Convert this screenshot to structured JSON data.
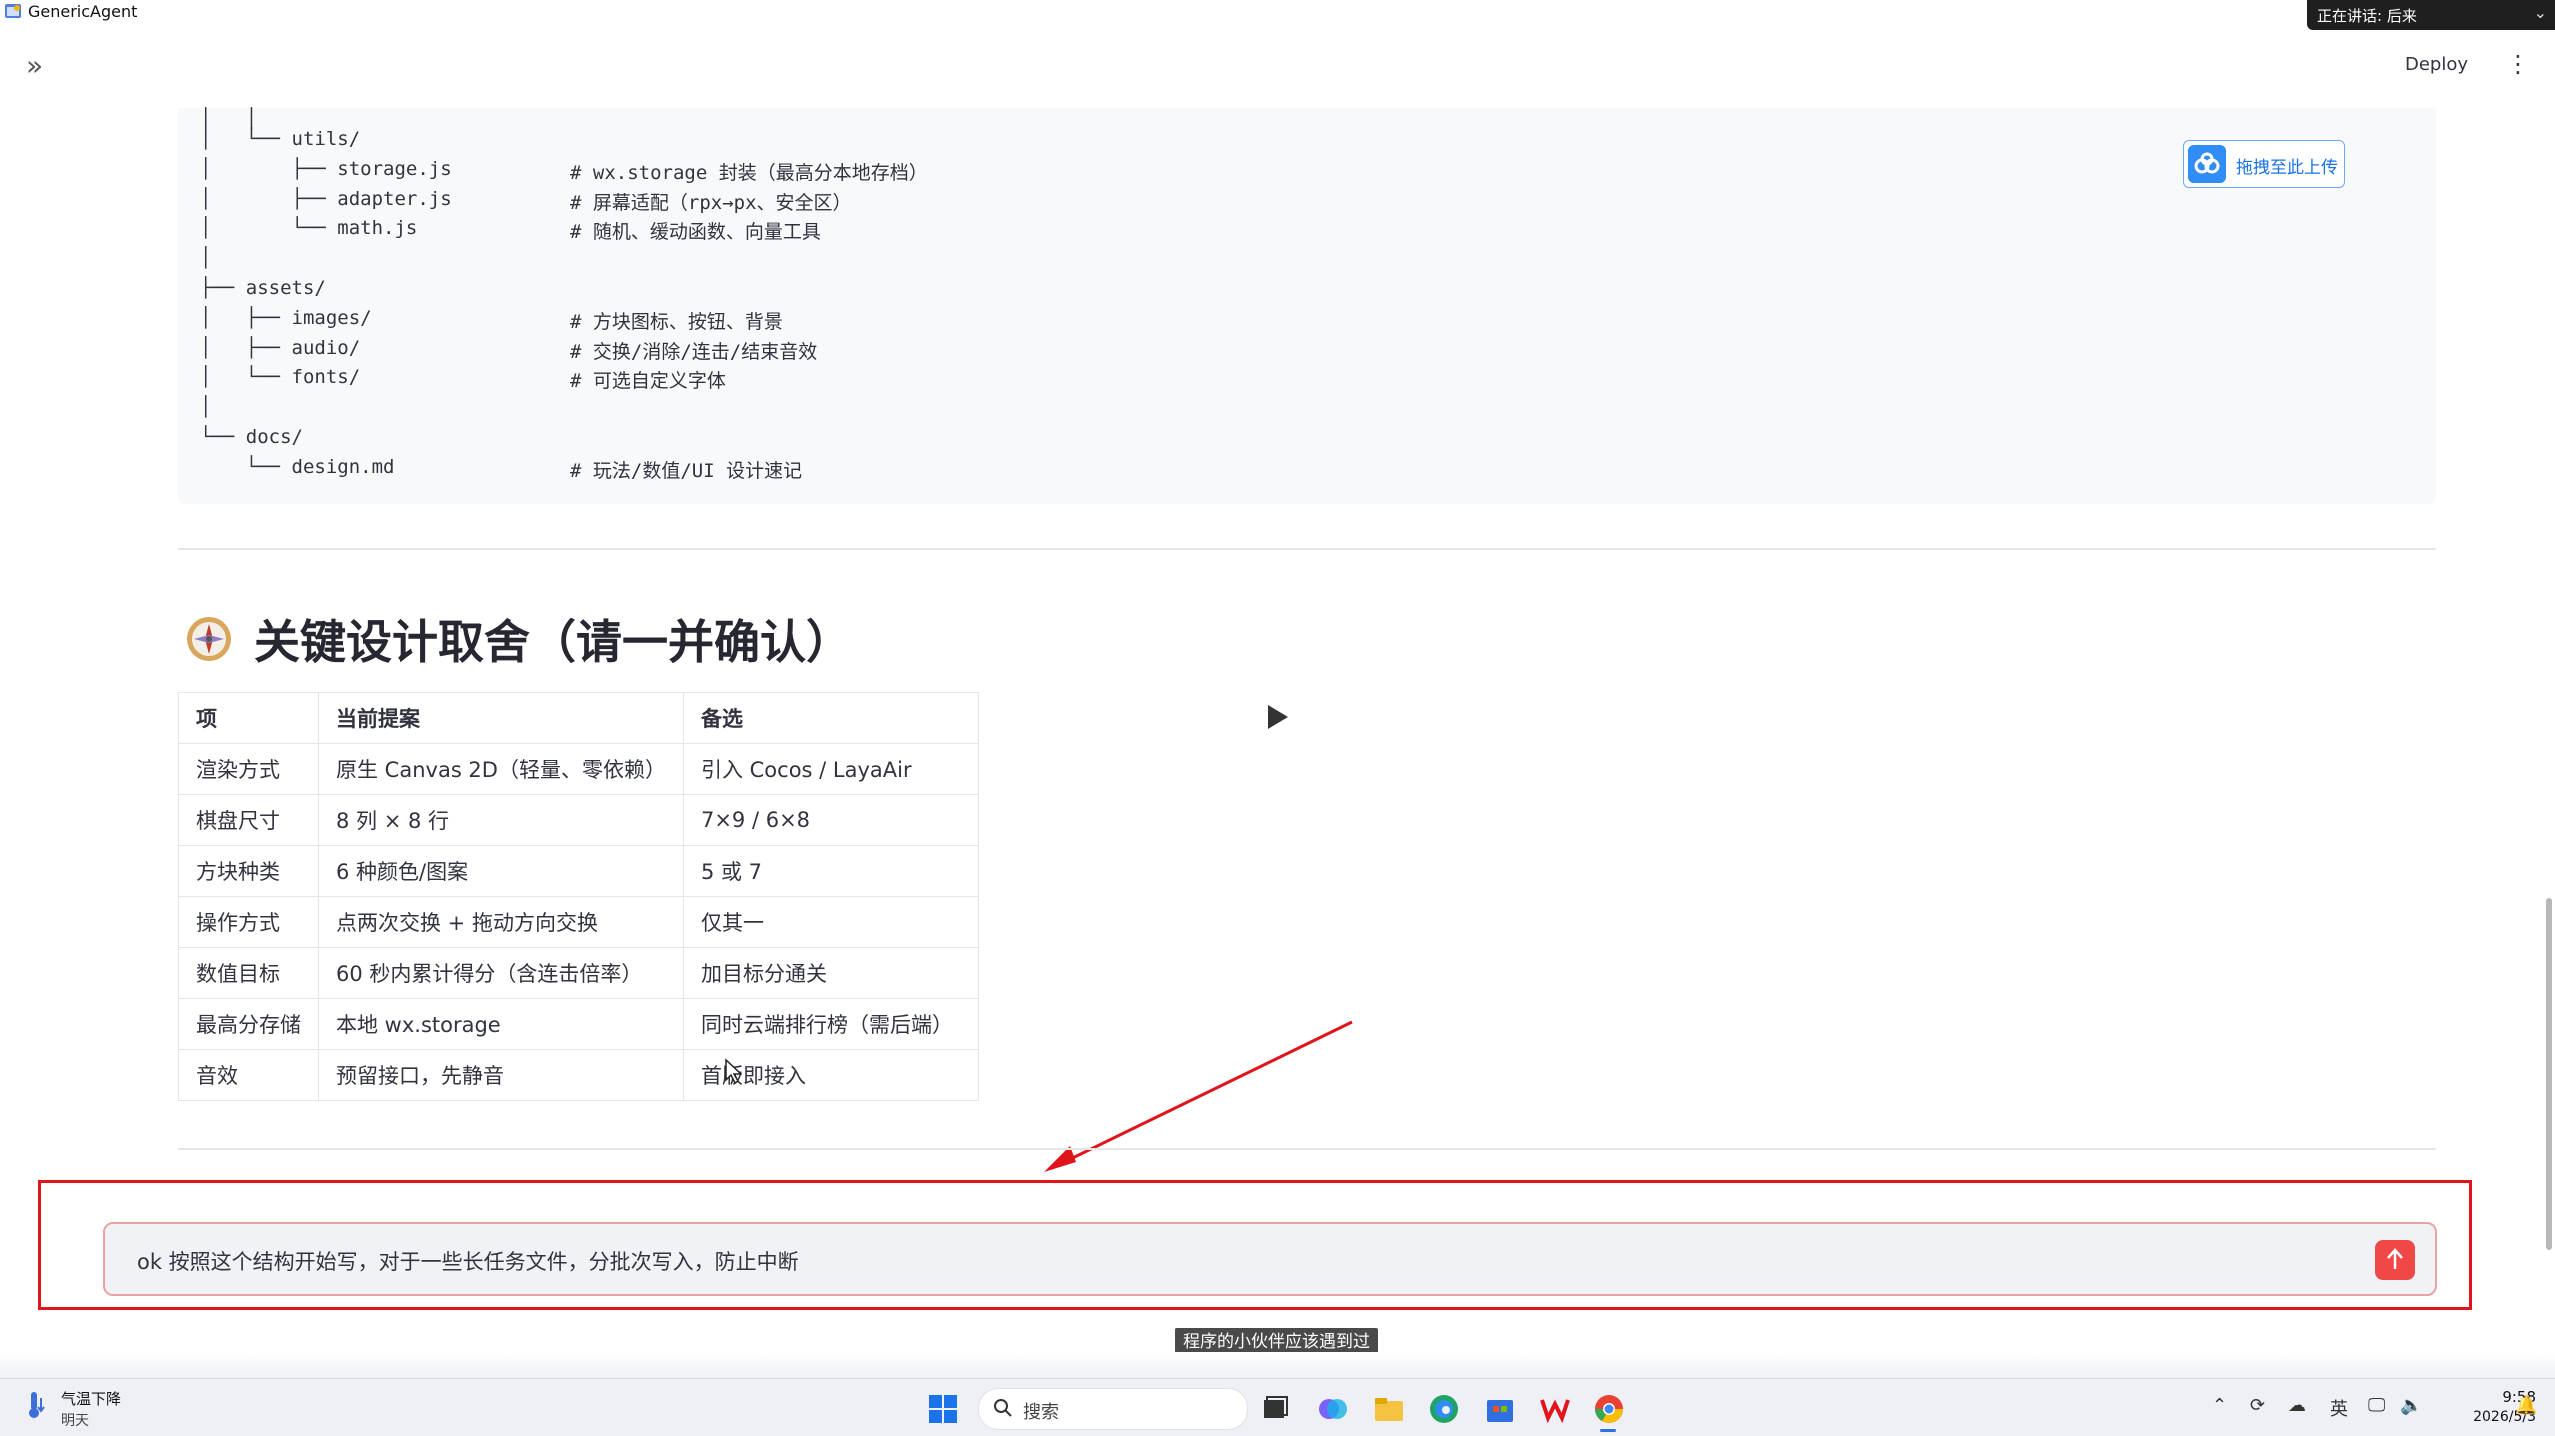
{
  "window": {
    "title": "GenericAgent",
    "speaking_label": "正在讲话: 后来"
  },
  "header": {
    "deploy_label": "Deploy",
    "expand_icon": "chevron-double-right-icon",
    "menu_icon": "kebab-menu-icon"
  },
  "code_tree": {
    "lines": [
      {
        "tree": "│   │",
        "comment": ""
      },
      {
        "tree": "│   └── utils/",
        "comment": ""
      },
      {
        "tree": "│       ├── storage.js",
        "comment": "# wx.storage 封装（最高分本地存档）"
      },
      {
        "tree": "│       ├── adapter.js",
        "comment": "# 屏幕适配（rpx→px、安全区）"
      },
      {
        "tree": "│       └── math.js",
        "comment": "# 随机、缓动函数、向量工具"
      },
      {
        "tree": "│",
        "comment": ""
      },
      {
        "tree": "├── assets/",
        "comment": ""
      },
      {
        "tree": "│   ├── images/",
        "comment": "# 方块图标、按钮、背景"
      },
      {
        "tree": "│   ├── audio/",
        "comment": "# 交换/消除/连击/结束音效"
      },
      {
        "tree": "│   └── fonts/",
        "comment": "# 可选自定义字体"
      },
      {
        "tree": "│",
        "comment": ""
      },
      {
        "tree": "└── docs/",
        "comment": ""
      },
      {
        "tree": "    └── design.md",
        "comment": "# 玩法/数值/UI 设计速记"
      }
    ]
  },
  "upload_button": {
    "label": "拖拽至此上传",
    "icon": "cloud-upload-icon"
  },
  "section": {
    "heading": "关键设计取舍（请一并确认）",
    "icon": "compass-icon"
  },
  "options_table": {
    "headers": [
      "项",
      "当前提案",
      "备选"
    ],
    "rows": [
      [
        "渲染方式",
        "原生 Canvas 2D（轻量、零依赖）",
        "引入 Cocos / LayaAir"
      ],
      [
        "棋盘尺寸",
        "8 列 × 8 行",
        "7×9 / 6×8"
      ],
      [
        "方块种类",
        "6 种颜色/图案",
        "5 或 7"
      ],
      [
        "操作方式",
        "点两次交换 + 拖动方向交换",
        "仅其一"
      ],
      [
        "数值目标",
        "60 秒内累计得分（含连击倍率）",
        "加目标分通关"
      ],
      [
        "最高分存储",
        "本地 wx.storage",
        "同时云端排行榜（需后端）"
      ],
      [
        "音效",
        "预留接口，先静音",
        "首版即接入"
      ]
    ]
  },
  "chat": {
    "input_value": "ok 按照这个结构开始写，对于一些长任务文件，分批次写入，防止中断",
    "send_icon": "arrow-up-icon"
  },
  "video_caption": "程序的小伙伴应该遇到过",
  "taskbar": {
    "weather_title": "气温下降",
    "weather_sub": "明天",
    "search_label": "搜索",
    "ime_label": "英",
    "time": "9:58",
    "date": "2026/5/3"
  },
  "colors": {
    "accent_red": "#f04747",
    "frame_red": "#e0141b",
    "upload_blue": "#2f8df5"
  }
}
